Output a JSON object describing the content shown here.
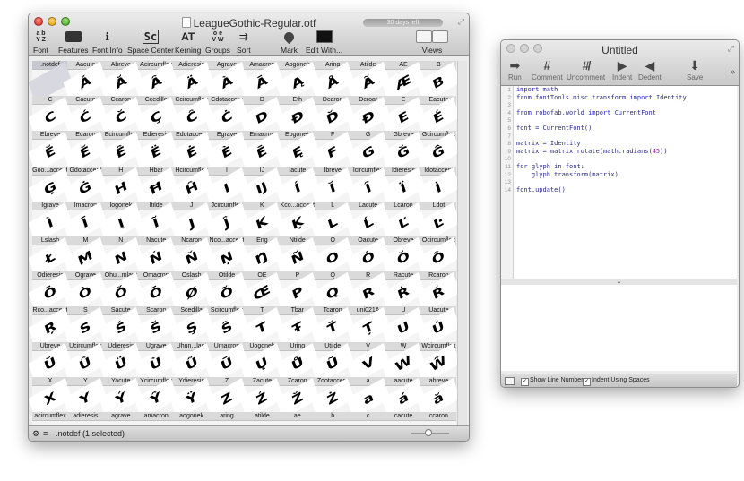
{
  "font_window": {
    "title": "LeagueGothic-Regular.otf",
    "trial_badge": "30 days left",
    "toolbar": [
      {
        "label": "Font",
        "icon": "font-icon"
      },
      {
        "label": "Features",
        "icon": "features-icon"
      },
      {
        "label": "Font Info",
        "icon": "font-info-icon"
      },
      {
        "label": "Space Center",
        "icon": "space-center-icon"
      },
      {
        "label": "Kerning",
        "icon": "kerning-icon"
      },
      {
        "label": "Groups",
        "icon": "groups-icon"
      },
      {
        "label": "Sort",
        "icon": "sort-icon"
      },
      {
        "label": "Mark",
        "icon": "mark-icon"
      },
      {
        "label": "Edit With...",
        "icon": "terminal-icon"
      },
      {
        "label": "Views",
        "icon": "views-icon"
      }
    ],
    "status_text": ".notdef (1 selected)",
    "glyphs": [
      {
        "name": ".notdef",
        "ch": ""
      },
      {
        "name": "Aacute",
        "ch": "Á"
      },
      {
        "name": "Abreve",
        "ch": "Ă"
      },
      {
        "name": "Acircumflex",
        "ch": "Â"
      },
      {
        "name": "Adieresis",
        "ch": "Ä"
      },
      {
        "name": "Agrave",
        "ch": "À"
      },
      {
        "name": "Amacron",
        "ch": "Ā"
      },
      {
        "name": "Aogonek",
        "ch": "Ą"
      },
      {
        "name": "Aring",
        "ch": "Å"
      },
      {
        "name": "Atilde",
        "ch": "Ã"
      },
      {
        "name": "AE",
        "ch": "Æ"
      },
      {
        "name": "B",
        "ch": "B"
      },
      {
        "name": "C",
        "ch": "C"
      },
      {
        "name": "Cacute",
        "ch": "Ć"
      },
      {
        "name": "Ccaron",
        "ch": "Č"
      },
      {
        "name": "Ccedilla",
        "ch": "Ç"
      },
      {
        "name": "Ccircumflex",
        "ch": "Ĉ"
      },
      {
        "name": "Cdotaccent",
        "ch": "Ċ"
      },
      {
        "name": "D",
        "ch": "D"
      },
      {
        "name": "Eth",
        "ch": "Ð"
      },
      {
        "name": "Dcaron",
        "ch": "Ď"
      },
      {
        "name": "Dcroat",
        "ch": "Đ"
      },
      {
        "name": "E",
        "ch": "E"
      },
      {
        "name": "Eacute",
        "ch": "É"
      },
      {
        "name": "Ebreve",
        "ch": "Ĕ"
      },
      {
        "name": "Ecaron",
        "ch": "Ě"
      },
      {
        "name": "Ecircumflex",
        "ch": "Ê"
      },
      {
        "name": "Edieresis",
        "ch": "Ë"
      },
      {
        "name": "Edotaccent",
        "ch": "Ė"
      },
      {
        "name": "Egrave",
        "ch": "È"
      },
      {
        "name": "Emacron",
        "ch": "Ē"
      },
      {
        "name": "Eogonek",
        "ch": "Ę"
      },
      {
        "name": "F",
        "ch": "F"
      },
      {
        "name": "G",
        "ch": "G"
      },
      {
        "name": "Gbreve",
        "ch": "Ğ"
      },
      {
        "name": "Gcircumflex",
        "ch": "Ĝ"
      },
      {
        "name": "Goo...accent",
        "ch": "Ģ"
      },
      {
        "name": "Gdotaccent",
        "ch": "Ġ"
      },
      {
        "name": "H",
        "ch": "H"
      },
      {
        "name": "Hbar",
        "ch": "Ħ"
      },
      {
        "name": "Hcircumflex",
        "ch": "Ĥ"
      },
      {
        "name": "I",
        "ch": "I"
      },
      {
        "name": "IJ",
        "ch": "Ĳ"
      },
      {
        "name": "Iacute",
        "ch": "Í"
      },
      {
        "name": "Ibreve",
        "ch": "Ĭ"
      },
      {
        "name": "Icircumflex",
        "ch": "Î"
      },
      {
        "name": "Idieresis",
        "ch": "Ï"
      },
      {
        "name": "Idotaccent",
        "ch": "İ"
      },
      {
        "name": "Igrave",
        "ch": "Ì"
      },
      {
        "name": "Imacron",
        "ch": "Ī"
      },
      {
        "name": "Iogonek",
        "ch": "Į"
      },
      {
        "name": "Itilde",
        "ch": "Ĩ"
      },
      {
        "name": "J",
        "ch": "J"
      },
      {
        "name": "Jcircumflex",
        "ch": "Ĵ"
      },
      {
        "name": "K",
        "ch": "K"
      },
      {
        "name": "Kco...accent",
        "ch": "Ķ"
      },
      {
        "name": "L",
        "ch": "L"
      },
      {
        "name": "Lacute",
        "ch": "Ĺ"
      },
      {
        "name": "Lcaron",
        "ch": "Ľ"
      },
      {
        "name": "Ldot",
        "ch": "Ŀ"
      },
      {
        "name": "Lslash",
        "ch": "Ł"
      },
      {
        "name": "M",
        "ch": "M"
      },
      {
        "name": "N",
        "ch": "N"
      },
      {
        "name": "Nacute",
        "ch": "Ń"
      },
      {
        "name": "Ncaron",
        "ch": "Ň"
      },
      {
        "name": "Nco...accent",
        "ch": "Ņ"
      },
      {
        "name": "Eng",
        "ch": "Ŋ"
      },
      {
        "name": "Ntilde",
        "ch": "Ñ"
      },
      {
        "name": "O",
        "ch": "O"
      },
      {
        "name": "Oacute",
        "ch": "Ó"
      },
      {
        "name": "Obreve",
        "ch": "Ŏ"
      },
      {
        "name": "Ocircumflex",
        "ch": "Ô"
      },
      {
        "name": "Odieresis",
        "ch": "Ö"
      },
      {
        "name": "Ograve",
        "ch": "Ò"
      },
      {
        "name": "Ohu...mlaut",
        "ch": "Ő"
      },
      {
        "name": "Omacron",
        "ch": "Ō"
      },
      {
        "name": "Oslash",
        "ch": "Ø"
      },
      {
        "name": "Otilde",
        "ch": "Õ"
      },
      {
        "name": "OE",
        "ch": "Œ"
      },
      {
        "name": "P",
        "ch": "P"
      },
      {
        "name": "Q",
        "ch": "Q"
      },
      {
        "name": "R",
        "ch": "R"
      },
      {
        "name": "Racute",
        "ch": "Ŕ"
      },
      {
        "name": "Rcaron",
        "ch": "Ř"
      },
      {
        "name": "Rco...accent",
        "ch": "Ŗ"
      },
      {
        "name": "S",
        "ch": "S"
      },
      {
        "name": "Sacute",
        "ch": "Ś"
      },
      {
        "name": "Scaron",
        "ch": "Š"
      },
      {
        "name": "Scedilla",
        "ch": "Ş"
      },
      {
        "name": "Scircumflex",
        "ch": "Ŝ"
      },
      {
        "name": "T",
        "ch": "T"
      },
      {
        "name": "Tbar",
        "ch": "Ŧ"
      },
      {
        "name": "Tcaron",
        "ch": "Ť"
      },
      {
        "name": "uni021A",
        "ch": "Ț"
      },
      {
        "name": "U",
        "ch": "U"
      },
      {
        "name": "Uacute",
        "ch": "Ú"
      },
      {
        "name": "Ubreve",
        "ch": "Ŭ"
      },
      {
        "name": "Ucircumflex",
        "ch": "Û"
      },
      {
        "name": "Udieresis",
        "ch": "Ü"
      },
      {
        "name": "Ugrave",
        "ch": "Ù"
      },
      {
        "name": "Uhun...laut",
        "ch": "Ű"
      },
      {
        "name": "Umacron",
        "ch": "Ū"
      },
      {
        "name": "Uogonek",
        "ch": "Ų"
      },
      {
        "name": "Uring",
        "ch": "Ů"
      },
      {
        "name": "Utilde",
        "ch": "Ũ"
      },
      {
        "name": "V",
        "ch": "V"
      },
      {
        "name": "W",
        "ch": "W"
      },
      {
        "name": "Wcircumflex",
        "ch": "Ŵ"
      },
      {
        "name": "X",
        "ch": "X"
      },
      {
        "name": "Y",
        "ch": "Y"
      },
      {
        "name": "Yacute",
        "ch": "Ý"
      },
      {
        "name": "Ycircumflex",
        "ch": "Ŷ"
      },
      {
        "name": "Ydieresis",
        "ch": "Ÿ"
      },
      {
        "name": "Z",
        "ch": "Z"
      },
      {
        "name": "Zacute",
        "ch": "Ź"
      },
      {
        "name": "Zcaron",
        "ch": "Ž"
      },
      {
        "name": "Zdotaccent",
        "ch": "Ż"
      },
      {
        "name": "a",
        "ch": "a"
      },
      {
        "name": "aacute",
        "ch": "á"
      },
      {
        "name": "abreve",
        "ch": "ă"
      },
      {
        "name": "acircumflex",
        "ch": ""
      },
      {
        "name": "adieresis",
        "ch": ""
      },
      {
        "name": "agrave",
        "ch": ""
      },
      {
        "name": "amacron",
        "ch": ""
      },
      {
        "name": "aogonek",
        "ch": ""
      },
      {
        "name": "aring",
        "ch": ""
      },
      {
        "name": "atilde",
        "ch": ""
      },
      {
        "name": "ae",
        "ch": ""
      },
      {
        "name": "b",
        "ch": ""
      },
      {
        "name": "c",
        "ch": ""
      },
      {
        "name": "cacute",
        "ch": ""
      },
      {
        "name": "ccaron",
        "ch": ""
      }
    ]
  },
  "script_window": {
    "title": "Untitled",
    "toolbar": [
      {
        "label": "Run",
        "icon": "run-icon"
      },
      {
        "label": "Comment",
        "icon": "comment-icon"
      },
      {
        "label": "Uncomment",
        "icon": "uncomment-icon"
      },
      {
        "label": "Indent",
        "icon": "indent-icon"
      },
      {
        "label": "Dedent",
        "icon": "dedent-icon"
      },
      {
        "label": "Save",
        "icon": "save-icon"
      }
    ],
    "code_lines": [
      "import math",
      "from fontTools.misc.transform import Identity",
      "",
      "from robofab.world import CurrentFont",
      "",
      "font = CurrentFont()",
      "",
      "matrix = Identity",
      "matrix = matrix.rotate(math.radians(45))",
      "",
      "for glyph in font:",
      "    glyph.transform(matrix)",
      "",
      "font.update()"
    ],
    "show_line_numbers_label": "Show Line Numbers",
    "indent_spaces_label": "Indent Using Spaces"
  },
  "colors": {
    "keyword": "#2323c4",
    "number": "#9a1a9a"
  }
}
